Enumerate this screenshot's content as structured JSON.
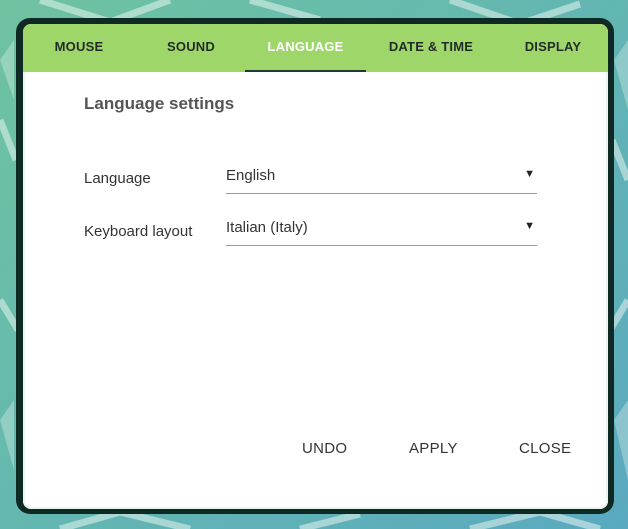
{
  "tabs": [
    {
      "label": "MOUSE",
      "active": false
    },
    {
      "label": "SOUND",
      "active": false
    },
    {
      "label": "LANGUAGE",
      "active": true
    },
    {
      "label": "DATE & TIME",
      "active": false
    },
    {
      "label": "DISPLAY",
      "active": false
    }
  ],
  "settings": {
    "title": "Language settings",
    "language": {
      "label": "Language",
      "value": "English"
    },
    "keyboard": {
      "label": "Keyboard layout",
      "value": "Italian (Italy)"
    }
  },
  "actions": {
    "undo_label": "UNDO",
    "apply_label": "APPLY",
    "close_label": "CLOSE"
  },
  "colors": {
    "tabbar": "#9fd66a",
    "frame": "#0f2a24",
    "active_tab_text": "#ffffff"
  },
  "icons": {
    "dropdown": "triangle-down"
  }
}
